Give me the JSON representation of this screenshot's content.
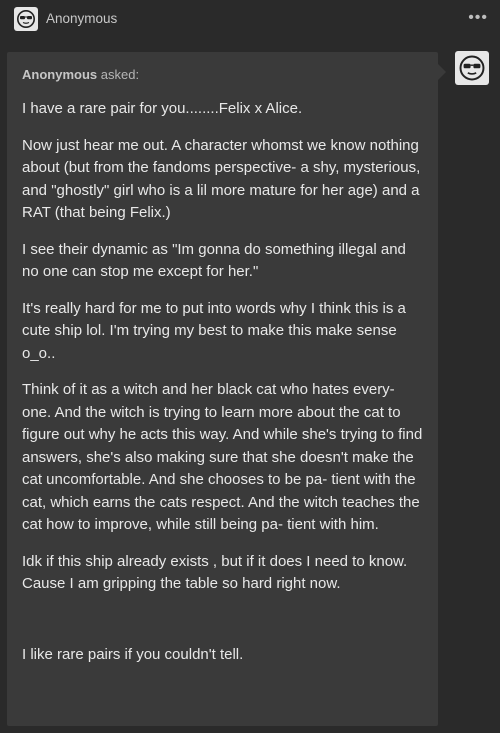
{
  "header": {
    "name": "Anonymous",
    "more_icon": "more-horizontal-icon",
    "avatar_icon": "sunglasses-face-icon"
  },
  "ask": {
    "asker": "Anonymous",
    "asked_label": "asked:",
    "paragraphs": [
      "I have a rare pair for you........Felix x Alice.",
      "Now just hear me out. A character whomst we know nothing about (but from the fandoms perspective- a shy, mysterious, and \"ghostly\" girl who is a lil more mature for her age) and a RAT (that being Felix.)",
      "I see their dynamic as \"Im gonna do something illegal and no one can stop me except for her.\"",
      "It's really hard for me to put into words why I think this is a cute ship lol. I'm trying my best to make this make sense o_o..",
      "Think of it as a witch and her black cat who hates every- one. And the witch is trying to learn more about the cat to figure out why he acts this way. And while she's trying to find answers, she's also making sure that she doesn't make the cat uncomfortable. And she chooses to be pa- tient with the cat, which earns the cats respect. And the witch teaches the cat how to improve, while still being pa- tient with him.",
      "Idk if this ship already exists , but if it does I need to know. Cause I am gripping the table so hard right now.",
      "I like rare pairs if you couldn't tell."
    ]
  },
  "colors": {
    "background": "#2a2a2a",
    "bubble": "#3a3a3a",
    "text": "#e8e8e8"
  }
}
